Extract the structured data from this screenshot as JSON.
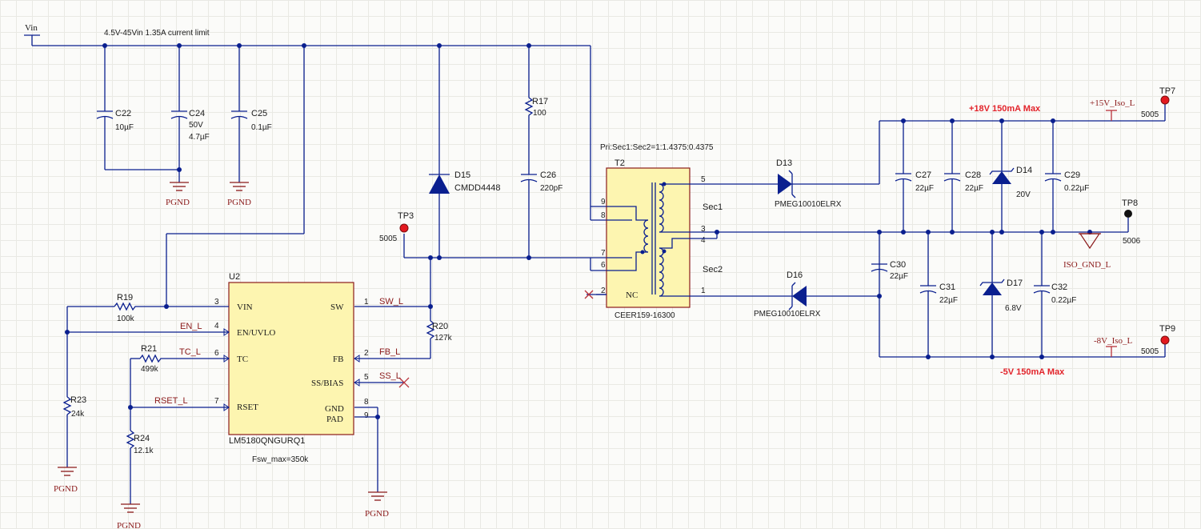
{
  "labels": {
    "vin": "Vin",
    "vin_note": "4.5V-45Vin 1.35A current limit",
    "pgnd": "PGND",
    "transformer_ratio": "Pri:Sec1:Sec2=1:1.4375:0.4375",
    "fsw": "Fsw_max=350k",
    "rail_pos": "+18V 150mA Max",
    "rail_neg": "-5V 150mA Max",
    "sec1": "Sec1",
    "sec2": "Sec2",
    "nc": "NC"
  },
  "nets": {
    "en": "EN_L",
    "tc": "TC_L",
    "rset": "RSET_L",
    "sw": "SW_L",
    "fb": "FB_L",
    "ss": "SS_L",
    "pos_out": "+15V_Iso_L",
    "neg_out": "-8V_Iso_L",
    "iso_gnd": "ISO_GND_L"
  },
  "components": {
    "c22": {
      "ref": "C22",
      "value": "10µF"
    },
    "c24": {
      "ref": "C24",
      "rating": "50V",
      "value": "4.7µF"
    },
    "c25": {
      "ref": "C25",
      "value": "0.1µF"
    },
    "r17": {
      "ref": "R17",
      "value": "100"
    },
    "c26": {
      "ref": "C26",
      "value": "220pF"
    },
    "d15": {
      "ref": "D15",
      "value": "CMDD4448"
    },
    "r19": {
      "ref": "R19",
      "value": "100k"
    },
    "r20": {
      "ref": "R20",
      "value": "127k"
    },
    "r21": {
      "ref": "R21",
      "value": "499k"
    },
    "r23": {
      "ref": "R23",
      "value": "24k"
    },
    "r24": {
      "ref": "R24",
      "value": "12.1k"
    },
    "u2": {
      "ref": "U2",
      "part": "LM5180QNGURQ1"
    },
    "t2": {
      "ref": "T2",
      "part": "CEER159-16300"
    },
    "d13": {
      "ref": "D13",
      "value": "PMEG10010ELRX"
    },
    "d16": {
      "ref": "D16",
      "value": "PMEG10010ELRX"
    },
    "c27": {
      "ref": "C27",
      "value": "22µF"
    },
    "c28": {
      "ref": "C28",
      "value": "22µF"
    },
    "d14": {
      "ref": "D14",
      "value": "20V"
    },
    "c29": {
      "ref": "C29",
      "value": "0.22µF"
    },
    "c30": {
      "ref": "C30",
      "value": "22µF"
    },
    "c31": {
      "ref": "C31",
      "value": "22µF"
    },
    "d17": {
      "ref": "D17",
      "value": "6.8V"
    },
    "c32": {
      "ref": "C32",
      "value": "0.22µF"
    }
  },
  "u2_pins": {
    "vin": {
      "num": "3",
      "name": "VIN"
    },
    "en": {
      "num": "4",
      "name": "EN/UVLO"
    },
    "tc": {
      "num": "6",
      "name": "TC"
    },
    "rset": {
      "num": "7",
      "name": "RSET"
    },
    "sw": {
      "num": "1",
      "name": "SW"
    },
    "fb": {
      "num": "2",
      "name": "FB"
    },
    "ss": {
      "num": "5",
      "name": "SS/BIAS"
    },
    "gnd": {
      "num": "8",
      "name": "GND"
    },
    "pad": {
      "num": "9",
      "name": "PAD"
    }
  },
  "t2_pins": {
    "p9": "9",
    "p8": "8",
    "p7": "7",
    "p6": "6",
    "p2": "2",
    "p5": "5",
    "p3": "3",
    "p4": "4",
    "p1": "1"
  },
  "test_points": [
    {
      "ref": "TP3",
      "value": "5005"
    },
    {
      "ref": "TP7",
      "value": "5005"
    },
    {
      "ref": "TP8",
      "value": "5006"
    },
    {
      "ref": "TP9",
      "value": "5005"
    }
  ],
  "colors": {
    "wire": "#0a1f8f",
    "symbol_border": "#8b1a1a",
    "ic_fill": "#fdf5b0",
    "testpoint": "#e3191f",
    "rail_note": "#e2232a"
  }
}
